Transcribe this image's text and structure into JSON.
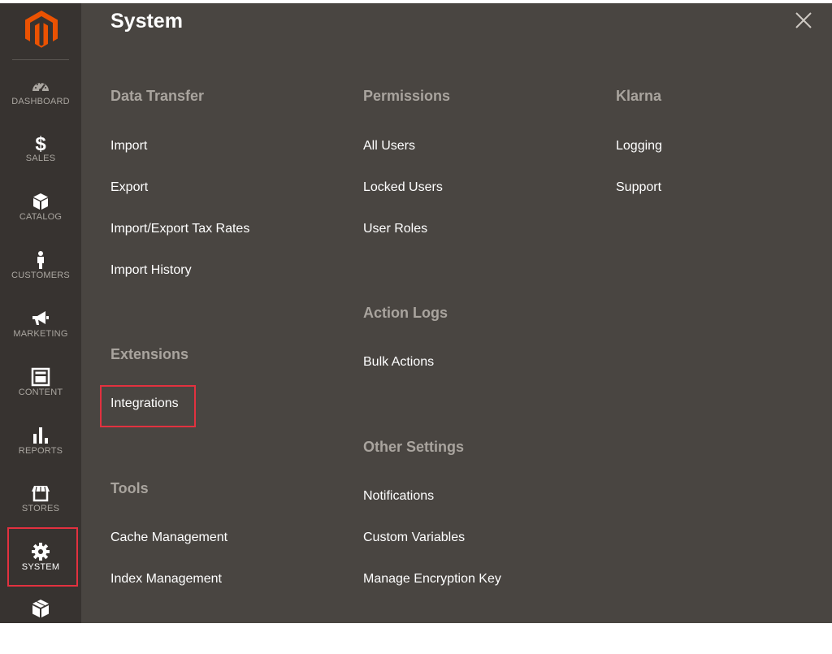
{
  "sidebar": {
    "items": [
      {
        "label": "DASHBOARD",
        "icon": "dashboard-icon"
      },
      {
        "label": "SALES",
        "icon": "dollar-icon"
      },
      {
        "label": "CATALOG",
        "icon": "cube-icon"
      },
      {
        "label": "CUSTOMERS",
        "icon": "person-icon"
      },
      {
        "label": "MARKETING",
        "icon": "megaphone-icon"
      },
      {
        "label": "CONTENT",
        "icon": "layout-icon"
      },
      {
        "label": "REPORTS",
        "icon": "bar-chart-icon"
      },
      {
        "label": "STORES",
        "icon": "store-icon"
      },
      {
        "label": "SYSTEM",
        "icon": "gear-icon",
        "active": true
      }
    ]
  },
  "panel": {
    "title": "System",
    "close_icon": "close-icon",
    "columns": [
      {
        "sections": [
          {
            "title": "Data Transfer",
            "links": [
              "Import",
              "Export",
              "Import/Export Tax Rates",
              "Import History"
            ]
          },
          {
            "title": "Extensions",
            "links": [
              "Integrations"
            ]
          },
          {
            "title": "Tools",
            "links": [
              "Cache Management",
              "Index Management"
            ]
          }
        ]
      },
      {
        "sections": [
          {
            "title": "Permissions",
            "links": [
              "All Users",
              "Locked Users",
              "User Roles"
            ]
          },
          {
            "title": "Action Logs",
            "links": [
              "Bulk Actions"
            ]
          },
          {
            "title": "Other Settings",
            "links": [
              "Notifications",
              "Custom Variables",
              "Manage Encryption Key"
            ]
          }
        ]
      },
      {
        "sections": [
          {
            "title": "Klarna",
            "links": [
              "Logging",
              "Support"
            ]
          }
        ]
      }
    ]
  },
  "colors": {
    "sidebar_bg": "#373330",
    "panel_bg": "#494541",
    "logo_orange": "#eb5202",
    "highlight_red": "#e2313f",
    "section_title": "#a9a49e",
    "link_text": "#ffffff"
  }
}
